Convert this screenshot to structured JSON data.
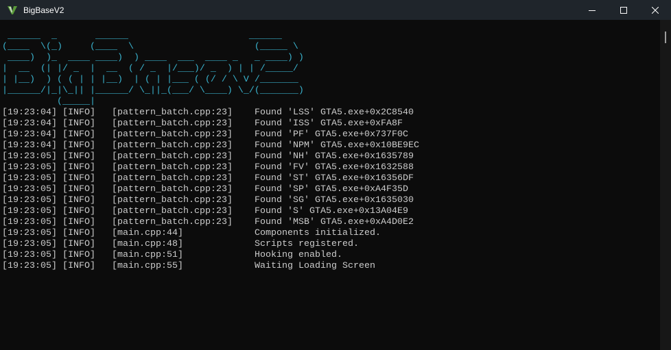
{
  "window": {
    "title": "BigBaseV2",
    "icon": "gta-v-logo-icon",
    "buttons": [
      "minimize",
      "maximize",
      "close"
    ]
  },
  "banner": {
    "lines": [
      " ______  _       ______                      ______  ",
      "(____  \\(_)     (____  \\                      (_____ \\ ",
      " ____)  )_  ____ ____)  ) ____  ___  ____ _   _ ____) )",
      "|  __  (| |/ _  |  __  ( / _  |/___)/ _  ) | | /_____/ ",
      "| |__)  ) ( ( | | |__)  | ( | |___ ( (/ / \\ V /_______ ",
      "|______/|_|\\_|| |______/ \\_||_(___/ \\____) \\_/(_______)",
      "          (_____|"
    ],
    "color": "#3ab4cf"
  },
  "log": [
    {
      "time": "[19:23:04]",
      "level": "[INFO]",
      "source": "[pattern_batch.cpp:23]",
      "message": "Found 'LSS' GTA5.exe+0x2C8540"
    },
    {
      "time": "[19:23:04]",
      "level": "[INFO]",
      "source": "[pattern_batch.cpp:23]",
      "message": "Found 'ISS' GTA5.exe+0xFA8F"
    },
    {
      "time": "[19:23:04]",
      "level": "[INFO]",
      "source": "[pattern_batch.cpp:23]",
      "message": "Found 'PF' GTA5.exe+0x737F0C"
    },
    {
      "time": "[19:23:04]",
      "level": "[INFO]",
      "source": "[pattern_batch.cpp:23]",
      "message": "Found 'NPM' GTA5.exe+0x10BE9EC"
    },
    {
      "time": "[19:23:05]",
      "level": "[INFO]",
      "source": "[pattern_batch.cpp:23]",
      "message": "Found 'NH' GTA5.exe+0x1635789"
    },
    {
      "time": "[19:23:05]",
      "level": "[INFO]",
      "source": "[pattern_batch.cpp:23]",
      "message": "Found 'FV' GTA5.exe+0x1632588"
    },
    {
      "time": "[19:23:05]",
      "level": "[INFO]",
      "source": "[pattern_batch.cpp:23]",
      "message": "Found 'ST' GTA5.exe+0x16356DF"
    },
    {
      "time": "[19:23:05]",
      "level": "[INFO]",
      "source": "[pattern_batch.cpp:23]",
      "message": "Found 'SP' GTA5.exe+0xA4F35D"
    },
    {
      "time": "[19:23:05]",
      "level": "[INFO]",
      "source": "[pattern_batch.cpp:23]",
      "message": "Found 'SG' GTA5.exe+0x1635030"
    },
    {
      "time": "[19:23:05]",
      "level": "[INFO]",
      "source": "[pattern_batch.cpp:23]",
      "message": "Found 'S' GTA5.exe+0x13A04E9"
    },
    {
      "time": "[19:23:05]",
      "level": "[INFO]",
      "source": "[pattern_batch.cpp:23]",
      "message": "Found 'MSB' GTA5.exe+0xA4D0E2"
    },
    {
      "time": "[19:23:05]",
      "level": "[INFO]",
      "source": "[main.cpp:44]",
      "message": "Components initialized."
    },
    {
      "time": "[19:23:05]",
      "level": "[INFO]",
      "source": "[main.cpp:48]",
      "message": "Scripts registered."
    },
    {
      "time": "[19:23:05]",
      "level": "[INFO]",
      "source": "[main.cpp:51]",
      "message": "Hooking enabled."
    },
    {
      "time": "[19:23:05]",
      "level": "[INFO]",
      "source": "[main.cpp:55]",
      "message": "Waiting Loading Screen"
    }
  ]
}
